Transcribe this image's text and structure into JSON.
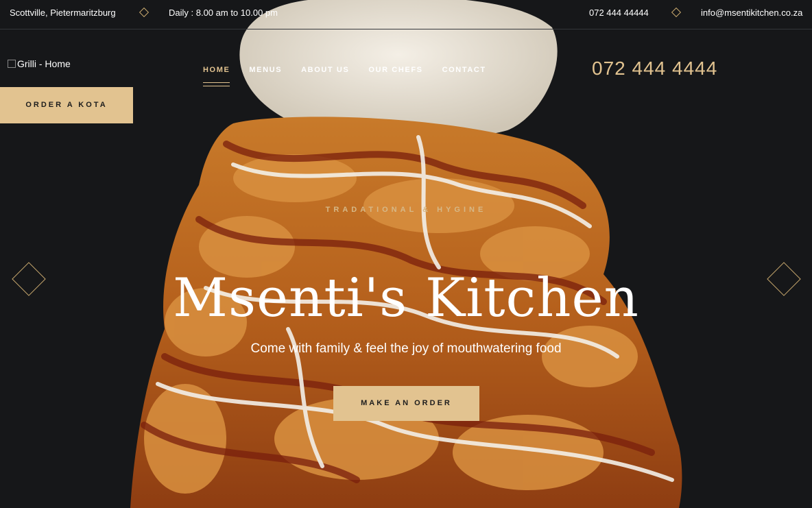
{
  "topbar": {
    "address": "Scottville, Pietermaritzburg",
    "hours": "Daily : 8.00 am to 10.00 pm",
    "phone": "072 444 44444",
    "email": "info@msentikitchen.co.za"
  },
  "header": {
    "logo_alt": "Grilli - Home",
    "order_button": "ORDER A KOTA",
    "phone": "072 444 4444",
    "nav": [
      {
        "label": "HOME",
        "active": true
      },
      {
        "label": "MENUS"
      },
      {
        "label": "ABOUT US"
      },
      {
        "label": "OUR CHEFS"
      },
      {
        "label": "CONTACT"
      }
    ]
  },
  "hero": {
    "tagline": "TRADATIONAL & HYGINE",
    "title": "Msenti's Kitchen",
    "subtitle": "Come with family & feel the joy of mouthwatering food",
    "cta": "MAKE AN ORDER"
  },
  "colors": {
    "background": "#161719",
    "accent": "#e2c390"
  },
  "icons": [
    "diamond-separator-icon",
    "prev-slide-icon",
    "next-slide-icon",
    "broken-image-icon"
  ]
}
